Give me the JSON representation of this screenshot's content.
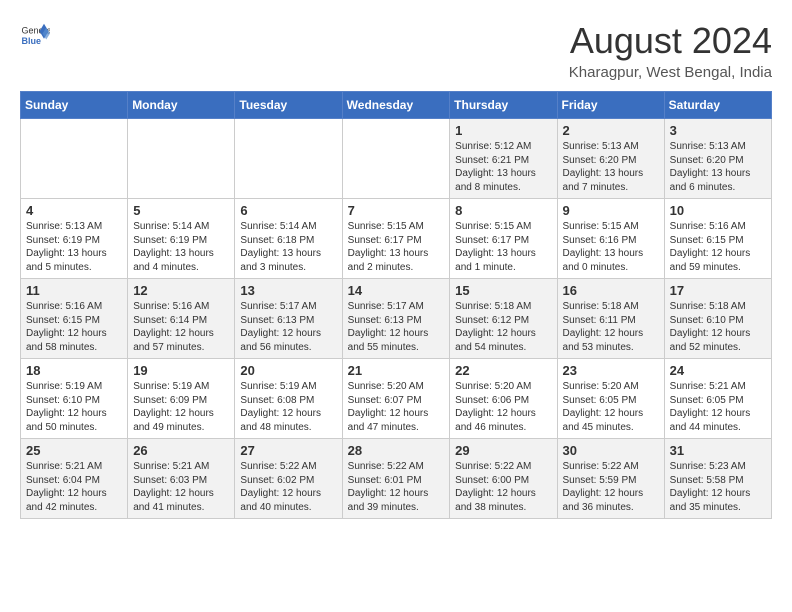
{
  "header": {
    "logo_general": "General",
    "logo_blue": "Blue",
    "month_year": "August 2024",
    "location": "Kharagpur, West Bengal, India"
  },
  "calendar": {
    "days_of_week": [
      "Sunday",
      "Monday",
      "Tuesday",
      "Wednesday",
      "Thursday",
      "Friday",
      "Saturday"
    ],
    "weeks": [
      [
        {
          "day": "",
          "info": ""
        },
        {
          "day": "",
          "info": ""
        },
        {
          "day": "",
          "info": ""
        },
        {
          "day": "",
          "info": ""
        },
        {
          "day": "1",
          "info": "Sunrise: 5:12 AM\nSunset: 6:21 PM\nDaylight: 13 hours\nand 8 minutes."
        },
        {
          "day": "2",
          "info": "Sunrise: 5:13 AM\nSunset: 6:20 PM\nDaylight: 13 hours\nand 7 minutes."
        },
        {
          "day": "3",
          "info": "Sunrise: 5:13 AM\nSunset: 6:20 PM\nDaylight: 13 hours\nand 6 minutes."
        }
      ],
      [
        {
          "day": "4",
          "info": "Sunrise: 5:13 AM\nSunset: 6:19 PM\nDaylight: 13 hours\nand 5 minutes."
        },
        {
          "day": "5",
          "info": "Sunrise: 5:14 AM\nSunset: 6:19 PM\nDaylight: 13 hours\nand 4 minutes."
        },
        {
          "day": "6",
          "info": "Sunrise: 5:14 AM\nSunset: 6:18 PM\nDaylight: 13 hours\nand 3 minutes."
        },
        {
          "day": "7",
          "info": "Sunrise: 5:15 AM\nSunset: 6:17 PM\nDaylight: 13 hours\nand 2 minutes."
        },
        {
          "day": "8",
          "info": "Sunrise: 5:15 AM\nSunset: 6:17 PM\nDaylight: 13 hours\nand 1 minute."
        },
        {
          "day": "9",
          "info": "Sunrise: 5:15 AM\nSunset: 6:16 PM\nDaylight: 13 hours\nand 0 minutes."
        },
        {
          "day": "10",
          "info": "Sunrise: 5:16 AM\nSunset: 6:15 PM\nDaylight: 12 hours\nand 59 minutes."
        }
      ],
      [
        {
          "day": "11",
          "info": "Sunrise: 5:16 AM\nSunset: 6:15 PM\nDaylight: 12 hours\nand 58 minutes."
        },
        {
          "day": "12",
          "info": "Sunrise: 5:16 AM\nSunset: 6:14 PM\nDaylight: 12 hours\nand 57 minutes."
        },
        {
          "day": "13",
          "info": "Sunrise: 5:17 AM\nSunset: 6:13 PM\nDaylight: 12 hours\nand 56 minutes."
        },
        {
          "day": "14",
          "info": "Sunrise: 5:17 AM\nSunset: 6:13 PM\nDaylight: 12 hours\nand 55 minutes."
        },
        {
          "day": "15",
          "info": "Sunrise: 5:18 AM\nSunset: 6:12 PM\nDaylight: 12 hours\nand 54 minutes."
        },
        {
          "day": "16",
          "info": "Sunrise: 5:18 AM\nSunset: 6:11 PM\nDaylight: 12 hours\nand 53 minutes."
        },
        {
          "day": "17",
          "info": "Sunrise: 5:18 AM\nSunset: 6:10 PM\nDaylight: 12 hours\nand 52 minutes."
        }
      ],
      [
        {
          "day": "18",
          "info": "Sunrise: 5:19 AM\nSunset: 6:10 PM\nDaylight: 12 hours\nand 50 minutes."
        },
        {
          "day": "19",
          "info": "Sunrise: 5:19 AM\nSunset: 6:09 PM\nDaylight: 12 hours\nand 49 minutes."
        },
        {
          "day": "20",
          "info": "Sunrise: 5:19 AM\nSunset: 6:08 PM\nDaylight: 12 hours\nand 48 minutes."
        },
        {
          "day": "21",
          "info": "Sunrise: 5:20 AM\nSunset: 6:07 PM\nDaylight: 12 hours\nand 47 minutes."
        },
        {
          "day": "22",
          "info": "Sunrise: 5:20 AM\nSunset: 6:06 PM\nDaylight: 12 hours\nand 46 minutes."
        },
        {
          "day": "23",
          "info": "Sunrise: 5:20 AM\nSunset: 6:05 PM\nDaylight: 12 hours\nand 45 minutes."
        },
        {
          "day": "24",
          "info": "Sunrise: 5:21 AM\nSunset: 6:05 PM\nDaylight: 12 hours\nand 44 minutes."
        }
      ],
      [
        {
          "day": "25",
          "info": "Sunrise: 5:21 AM\nSunset: 6:04 PM\nDaylight: 12 hours\nand 42 minutes."
        },
        {
          "day": "26",
          "info": "Sunrise: 5:21 AM\nSunset: 6:03 PM\nDaylight: 12 hours\nand 41 minutes."
        },
        {
          "day": "27",
          "info": "Sunrise: 5:22 AM\nSunset: 6:02 PM\nDaylight: 12 hours\nand 40 minutes."
        },
        {
          "day": "28",
          "info": "Sunrise: 5:22 AM\nSunset: 6:01 PM\nDaylight: 12 hours\nand 39 minutes."
        },
        {
          "day": "29",
          "info": "Sunrise: 5:22 AM\nSunset: 6:00 PM\nDaylight: 12 hours\nand 38 minutes."
        },
        {
          "day": "30",
          "info": "Sunrise: 5:22 AM\nSunset: 5:59 PM\nDaylight: 12 hours\nand 36 minutes."
        },
        {
          "day": "31",
          "info": "Sunrise: 5:23 AM\nSunset: 5:58 PM\nDaylight: 12 hours\nand 35 minutes."
        }
      ]
    ]
  }
}
